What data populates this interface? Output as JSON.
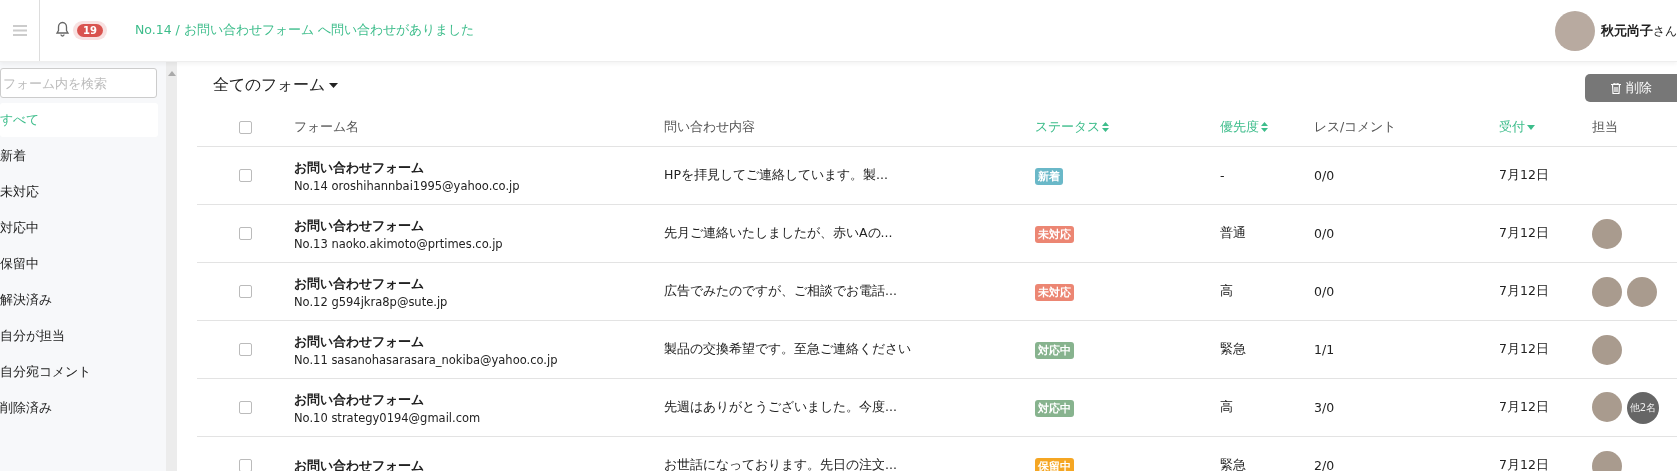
{
  "header": {
    "notification_count": "19",
    "notification_text": "No.14 / お問い合わせフォーム へ問い合わせがありました",
    "user_name": "秋元尚子",
    "user_suffix": "さん"
  },
  "sidebar": {
    "search": {
      "placeholder": "フォーム内を検索"
    },
    "items": [
      {
        "label": "すべて",
        "selected": true
      },
      {
        "label": "新着",
        "selected": false
      },
      {
        "label": "未対応",
        "selected": false
      },
      {
        "label": "対応中",
        "selected": false
      },
      {
        "label": "保留中",
        "selected": false
      },
      {
        "label": "解決済み",
        "selected": false
      },
      {
        "label": "自分が担当",
        "selected": false
      },
      {
        "label": "自分宛コメント",
        "selected": false
      },
      {
        "label": "削除済み",
        "selected": false
      }
    ]
  },
  "main": {
    "title": "全てのフォーム",
    "delete_button": "削除"
  },
  "table": {
    "select_all": {
      "checked": false
    },
    "columns": [
      {
        "label": "フォーム名",
        "kind": "plain"
      },
      {
        "label": "問い合わせ内容",
        "kind": "plain"
      },
      {
        "label": "ステータス",
        "kind": "sortable"
      },
      {
        "label": "優先度",
        "kind": "sortable"
      },
      {
        "label": "レス/コメント",
        "kind": "plain"
      },
      {
        "label": "受付",
        "kind": "sorted"
      },
      {
        "label": "担当",
        "kind": "plain"
      }
    ],
    "rows": [
      {
        "checked": false,
        "form": "お問い合わせフォーム",
        "sub": "No.14 oroshihannbai1995@yahoo.co.jp",
        "content": "HPを拝見してご連絡しています。製...",
        "status": {
          "label": "新着",
          "color": "#6ab8c8"
        },
        "priority": "-",
        "count": "0/0",
        "date": "7月12日",
        "assignees": []
      },
      {
        "checked": false,
        "form": "お問い合わせフォーム",
        "sub": "No.13 naoko.akimoto@prtimes.co.jp",
        "content": "先月ご連絡いたしましたが、赤いAの...",
        "status": {
          "label": "未対応",
          "color": "#ec8673"
        },
        "priority": "普通",
        "count": "0/0",
        "date": "7月12日",
        "assignees": [
          {
            "kind": "photo"
          }
        ]
      },
      {
        "checked": false,
        "form": "お問い合わせフォーム",
        "sub": "No.12 g594jkra8p@sute.jp",
        "content": "広告でみたのですが、ご相談でお電話...",
        "status": {
          "label": "未対応",
          "color": "#ec8673"
        },
        "priority": "高",
        "count": "0/0",
        "date": "7月12日",
        "assignees": [
          {
            "kind": "photo"
          },
          {
            "kind": "photo"
          }
        ]
      },
      {
        "checked": false,
        "form": "お問い合わせフォーム",
        "sub": "No.11 sasanohasarasara_nokiba@yahoo.co.jp",
        "content": "製品の交換希望です。至急ご連絡ください",
        "status": {
          "label": "対応中",
          "color": "#87b38e"
        },
        "priority": "緊急",
        "count": "1/1",
        "date": "7月12日",
        "assignees": [
          {
            "kind": "photo"
          }
        ]
      },
      {
        "checked": false,
        "form": "お問い合わせフォーム",
        "sub": "No.10 strategy0194@gmail.com",
        "content": "先週はありがとうございました。今度...",
        "status": {
          "label": "対応中",
          "color": "#87b38e"
        },
        "priority": "高",
        "count": "3/0",
        "date": "7月12日",
        "assignees": [
          {
            "kind": "photo"
          },
          {
            "kind": "more",
            "label": "他2名"
          }
        ]
      },
      {
        "checked": false,
        "form": "お問い合わせフォーム",
        "content": "お世話になっております。先日の注文...",
        "status": {
          "label": "保留中",
          "color": "#f5a623"
        },
        "priority": "緊急",
        "count": "2/0",
        "date": "7月12日",
        "assignees": [
          {
            "kind": "photo"
          }
        ]
      }
    ]
  }
}
